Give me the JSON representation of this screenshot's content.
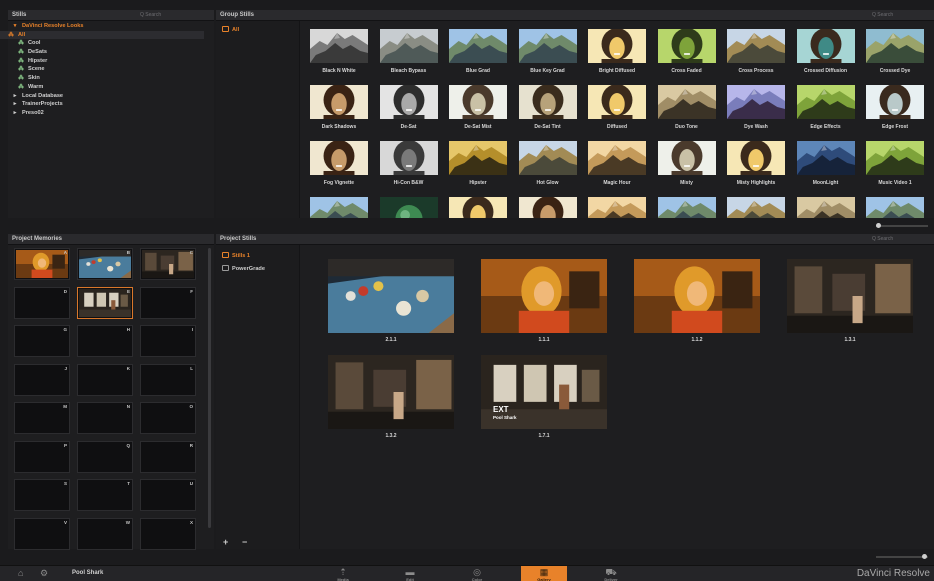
{
  "stills_panel": {
    "title": "Stills",
    "search_placeholder": "Q Search"
  },
  "tree": [
    {
      "label": "DaVinci Resolve Looks",
      "level": 0,
      "expanded": true,
      "selected": true
    },
    {
      "label": "All",
      "level": 1,
      "selected": true
    },
    {
      "label": "Cool",
      "level": 1
    },
    {
      "label": "DeSats",
      "level": 1
    },
    {
      "label": "Hipster",
      "level": 1
    },
    {
      "label": "Scene",
      "level": 1
    },
    {
      "label": "Skin",
      "level": 1
    },
    {
      "label": "Warm",
      "level": 1
    },
    {
      "label": "Local Database",
      "level": 0
    },
    {
      "label": "TrainerProjects",
      "level": 0
    },
    {
      "label": "Preso02",
      "level": 0
    }
  ],
  "group_stills": {
    "title": "Group Stills",
    "search_placeholder": "Q Search",
    "sidebar_item": "All"
  },
  "looks": [
    {
      "label": "Black N White",
      "kind": "mountain",
      "tone": "bw"
    },
    {
      "label": "Bleach Bypass",
      "kind": "mountain",
      "tone": "bleach"
    },
    {
      "label": "Blue Grad",
      "kind": "mountain",
      "tone": "blue"
    },
    {
      "label": "Blue Key Grad",
      "kind": "mountain",
      "tone": "blue"
    },
    {
      "label": "Bright Diffused",
      "kind": "face",
      "tone": "bright"
    },
    {
      "label": "Cross Faded",
      "kind": "face",
      "tone": "green"
    },
    {
      "label": "Cross Process",
      "kind": "mountain",
      "tone": "cross"
    },
    {
      "label": "Crossed Diffusion",
      "kind": "face",
      "tone": "teal"
    },
    {
      "label": "Crossed Dye",
      "kind": "mountain",
      "tone": "dye"
    },
    {
      "label": "Dark Shadows",
      "kind": "face",
      "tone": "warm"
    },
    {
      "label": "De-Sat",
      "kind": "face",
      "tone": "desat"
    },
    {
      "label": "De-Sat Mist",
      "kind": "face",
      "tone": "mist"
    },
    {
      "label": "De-Sat Tint",
      "kind": "face",
      "tone": "tint"
    },
    {
      "label": "Diffused",
      "kind": "face",
      "tone": "bright"
    },
    {
      "label": "Duo Tone",
      "kind": "mountain",
      "tone": "duo"
    },
    {
      "label": "Dye Wash",
      "kind": "mountain",
      "tone": "purple"
    },
    {
      "label": "Edge Effects",
      "kind": "mountain",
      "tone": "green"
    },
    {
      "label": "Edge Frost",
      "kind": "face",
      "tone": "frost"
    },
    {
      "label": "Fog Vignette",
      "kind": "face",
      "tone": "warm"
    },
    {
      "label": "Hi-Con B&W",
      "kind": "face",
      "tone": "bw"
    },
    {
      "label": "Hipster",
      "kind": "mountain",
      "tone": "gold"
    },
    {
      "label": "Hot Glow",
      "kind": "mountain",
      "tone": "cross"
    },
    {
      "label": "Magic Hour",
      "kind": "mountain",
      "tone": "magic"
    },
    {
      "label": "Misty",
      "kind": "face",
      "tone": "mist"
    },
    {
      "label": "Misty Highlights",
      "kind": "face",
      "tone": "bright"
    },
    {
      "label": "MoonLight",
      "kind": "mountain",
      "tone": "moon"
    },
    {
      "label": "Music Video 1",
      "kind": "mountain",
      "tone": "green"
    },
    {
      "label": "",
      "kind": "mountain",
      "tone": "blue"
    },
    {
      "label": "",
      "kind": "orb",
      "tone": "green"
    },
    {
      "label": "",
      "kind": "face",
      "tone": "bright"
    },
    {
      "label": "",
      "kind": "face",
      "tone": "warm"
    },
    {
      "label": "",
      "kind": "mountain",
      "tone": "magic"
    },
    {
      "label": "",
      "kind": "mountain",
      "tone": "blue"
    },
    {
      "label": "",
      "kind": "mountain",
      "tone": "cross"
    },
    {
      "label": "",
      "kind": "mountain",
      "tone": "duo"
    },
    {
      "label": "",
      "kind": "mountain",
      "tone": "blue"
    }
  ],
  "project_memories": {
    "title": "Project Memories",
    "slots": [
      {
        "key": "A",
        "image": "woman"
      },
      {
        "key": "B",
        "image": "pool"
      },
      {
        "key": "C",
        "image": "room"
      },
      {
        "key": "D",
        "image": ""
      },
      {
        "key": "E",
        "image": "window",
        "selected": true
      },
      {
        "key": "F",
        "image": ""
      },
      {
        "key": "G",
        "image": ""
      },
      {
        "key": "H",
        "image": ""
      },
      {
        "key": "I",
        "image": ""
      },
      {
        "key": "J",
        "image": ""
      },
      {
        "key": "K",
        "image": ""
      },
      {
        "key": "L",
        "image": ""
      },
      {
        "key": "M",
        "image": ""
      },
      {
        "key": "N",
        "image": ""
      },
      {
        "key": "O",
        "image": ""
      },
      {
        "key": "P",
        "image": ""
      },
      {
        "key": "Q",
        "image": ""
      },
      {
        "key": "R",
        "image": ""
      },
      {
        "key": "S",
        "image": ""
      },
      {
        "key": "T",
        "image": ""
      },
      {
        "key": "U",
        "image": ""
      },
      {
        "key": "V",
        "image": ""
      },
      {
        "key": "W",
        "image": ""
      },
      {
        "key": "X",
        "image": ""
      }
    ]
  },
  "project_stills": {
    "title": "Project Stills",
    "search_placeholder": "Q Search",
    "albums": [
      {
        "label": "Stills 1",
        "selected": true
      },
      {
        "label": "PowerGrade",
        "selected": false
      }
    ],
    "add_label": "+",
    "remove_label": "−",
    "stills": [
      {
        "label": "2.1.1",
        "image": "pool"
      },
      {
        "label": "1.1.1",
        "image": "woman"
      },
      {
        "label": "1.1.2",
        "image": "woman"
      },
      {
        "label": "1.3.1",
        "image": "room"
      },
      {
        "label": "1.3.2",
        "image": "room"
      },
      {
        "label": "1.7.1",
        "image": "window",
        "overlay_title": "EXT",
        "overlay_sub": "Pool Shark"
      }
    ]
  },
  "bottom_bar": {
    "project_name": "Pool Shark",
    "brand": "DaVinci Resolve",
    "pages": [
      {
        "name": "Media",
        "icon": "⇡"
      },
      {
        "name": "Edit",
        "icon": "▬"
      },
      {
        "name": "Color",
        "icon": "◎"
      },
      {
        "name": "Gallery",
        "icon": "▦",
        "active": true
      },
      {
        "name": "Deliver",
        "icon": "⛟"
      }
    ]
  },
  "colors": {
    "accent": "#e8822a",
    "panel": "#1e1e20",
    "header": "#2a2a2d"
  }
}
